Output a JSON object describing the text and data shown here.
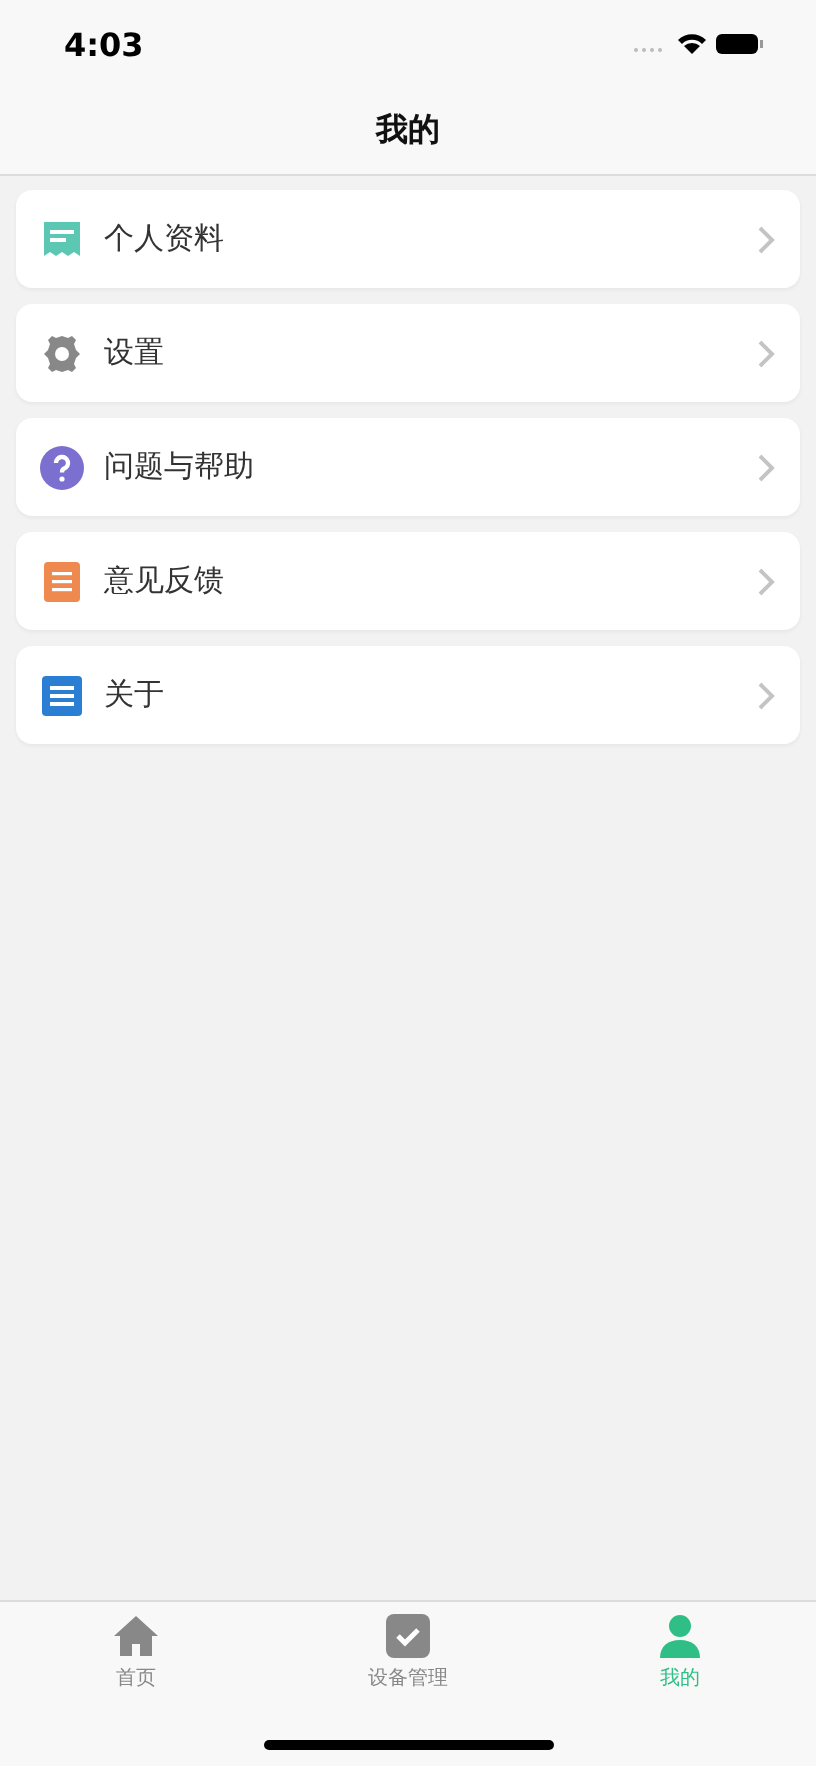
{
  "status_bar": {
    "time": "4:03"
  },
  "nav": {
    "title": "我的"
  },
  "menu": [
    {
      "kind": "profile",
      "label": "个人资料"
    },
    {
      "kind": "settings",
      "label": "设置"
    },
    {
      "kind": "help",
      "label": "问题与帮助"
    },
    {
      "kind": "feedback",
      "label": "意见反馈"
    },
    {
      "kind": "about",
      "label": "关于"
    }
  ],
  "tabs": [
    {
      "kind": "home",
      "label": "首页",
      "selected": false
    },
    {
      "kind": "devices",
      "label": "设备管理",
      "selected": false
    },
    {
      "kind": "me",
      "label": "我的",
      "selected": true
    }
  ]
}
